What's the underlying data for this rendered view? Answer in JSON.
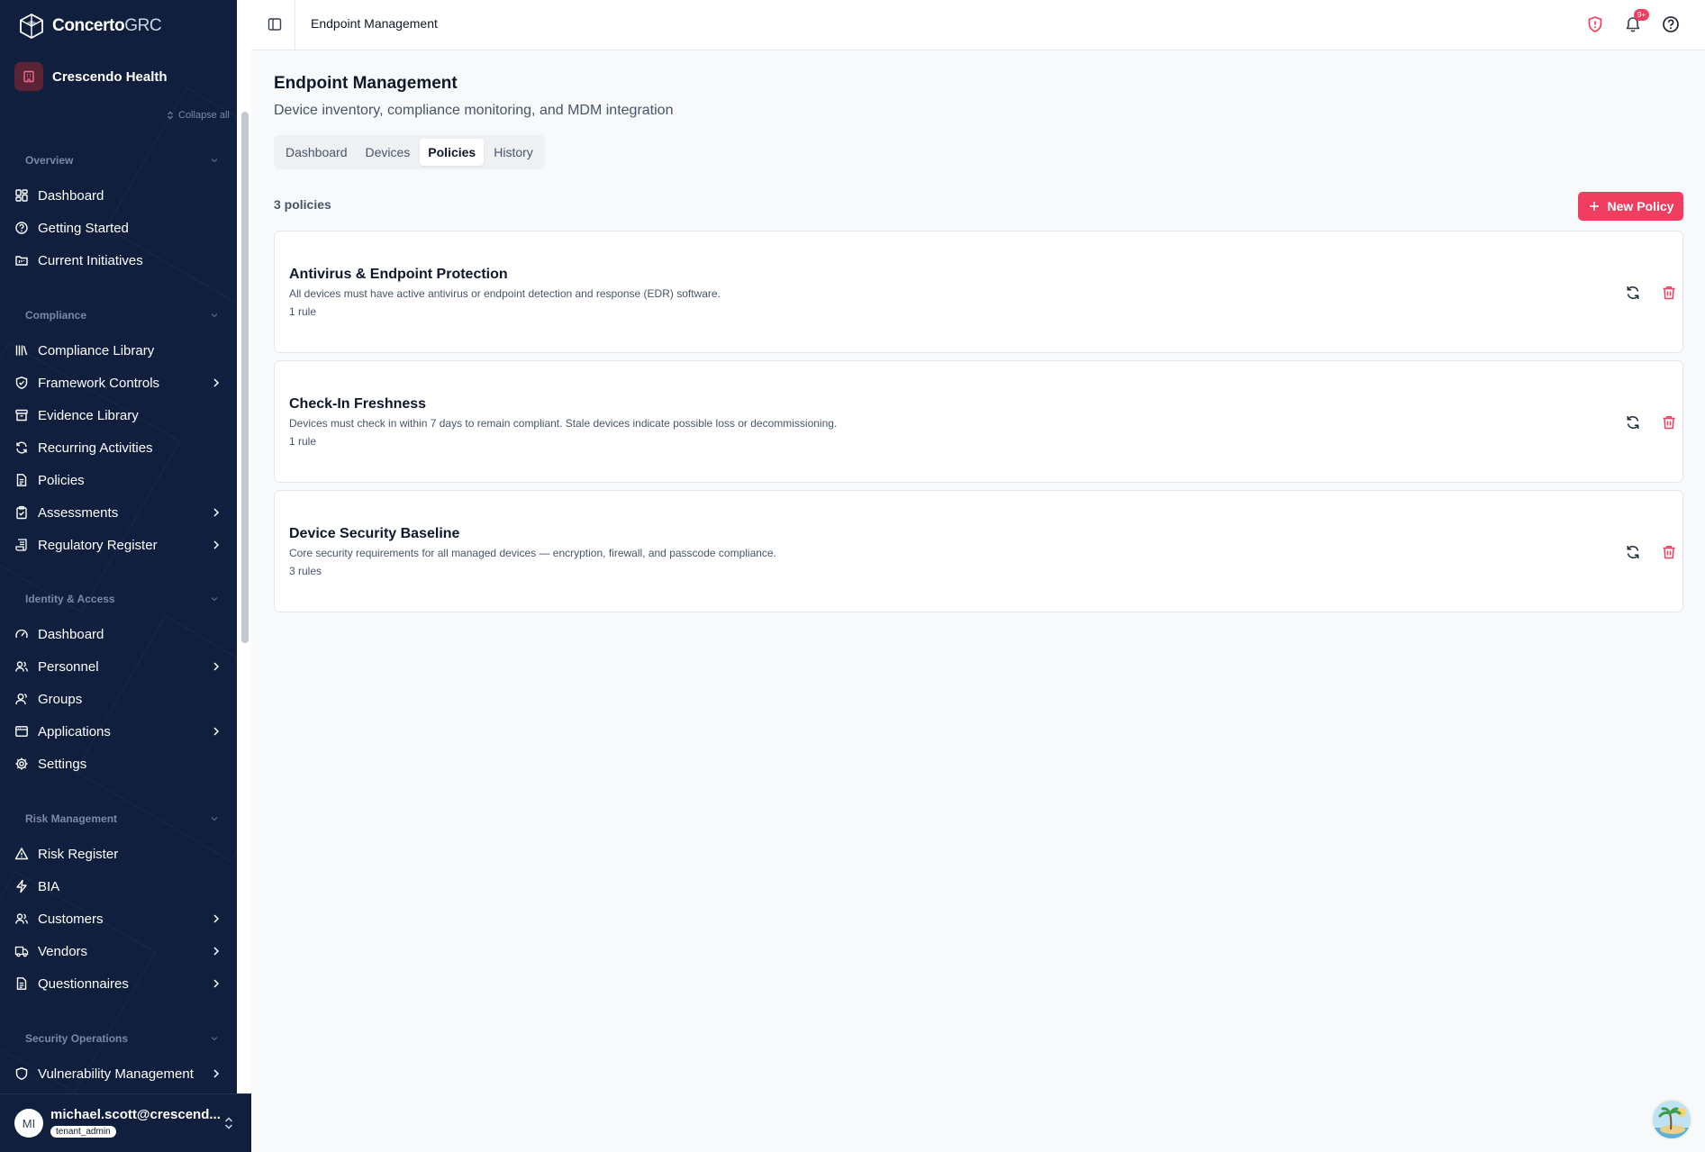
{
  "app": {
    "brand_bold": "Concerto",
    "brand_light": "GRC",
    "tenant": "Crescendo Health",
    "collapse_all": "Collapse all"
  },
  "sidebar": {
    "sections": [
      {
        "title": "Overview",
        "items": [
          {
            "label": "Dashboard",
            "icon": "dashboard-grid-icon",
            "has_children": false
          },
          {
            "label": "Getting Started",
            "icon": "help-circle-icon",
            "has_children": false
          },
          {
            "label": "Current Initiatives",
            "icon": "folder-kanban-icon",
            "has_children": false
          }
        ]
      },
      {
        "title": "Compliance",
        "items": [
          {
            "label": "Compliance Library",
            "icon": "library-icon",
            "has_children": false
          },
          {
            "label": "Framework Controls",
            "icon": "shield-check-icon",
            "has_children": true
          },
          {
            "label": "Evidence Library",
            "icon": "archive-icon",
            "has_children": false
          },
          {
            "label": "Recurring Activities",
            "icon": "refresh-icon",
            "has_children": false
          },
          {
            "label": "Policies",
            "icon": "file-text-icon",
            "has_children": false
          },
          {
            "label": "Assessments",
            "icon": "clipboard-check-icon",
            "has_children": true
          },
          {
            "label": "Regulatory Register",
            "icon": "scroll-icon",
            "has_children": true
          }
        ]
      },
      {
        "title": "Identity & Access",
        "items": [
          {
            "label": "Dashboard",
            "icon": "gauge-icon",
            "has_children": false
          },
          {
            "label": "Personnel",
            "icon": "users-icon",
            "has_children": true
          },
          {
            "label": "Groups",
            "icon": "user-group-icon",
            "has_children": false
          },
          {
            "label": "Applications",
            "icon": "app-window-icon",
            "has_children": true
          },
          {
            "label": "Settings",
            "icon": "gear-icon",
            "has_children": false
          }
        ]
      },
      {
        "title": "Risk Management",
        "items": [
          {
            "label": "Risk Register",
            "icon": "alert-triangle-icon",
            "has_children": false
          },
          {
            "label": "BIA",
            "icon": "zap-icon",
            "has_children": false
          },
          {
            "label": "Customers",
            "icon": "users-icon",
            "has_children": true
          },
          {
            "label": "Vendors",
            "icon": "truck-icon",
            "has_children": true
          },
          {
            "label": "Questionnaires",
            "icon": "file-text-icon",
            "has_children": true
          }
        ]
      },
      {
        "title": "Security Operations",
        "items": [
          {
            "label": "Vulnerability Management",
            "icon": "shield-icon",
            "has_children": true
          }
        ]
      }
    ]
  },
  "user": {
    "initials": "MI",
    "email": "michael.scott@crescend...",
    "role": "tenant_admin"
  },
  "topbar": {
    "title": "Endpoint Management",
    "notification_badge": "9+"
  },
  "page": {
    "title": "Endpoint Management",
    "subtitle": "Device inventory, compliance monitoring, and MDM integration",
    "tabs": [
      {
        "label": "Dashboard",
        "active": false
      },
      {
        "label": "Devices",
        "active": false
      },
      {
        "label": "Policies",
        "active": true
      },
      {
        "label": "History",
        "active": false
      }
    ],
    "count_label": "3 policies",
    "new_policy_label": "New Policy",
    "policies": [
      {
        "title": "Antivirus & Endpoint Protection",
        "description": "All devices must have active antivirus or endpoint detection and response (EDR) software.",
        "rules": "1 rule"
      },
      {
        "title": "Check-In Freshness",
        "description": "Devices must check in within 7 days to remain compliant. Stale devices indicate possible loss or decommissioning.",
        "rules": "1 rule"
      },
      {
        "title": "Device Security Baseline",
        "description": "Core security requirements for all managed devices — encryption, firewall, and passcode compliance.",
        "rules": "3 rules"
      }
    ]
  },
  "colors": {
    "sidebar_bg": "#0f1f3d",
    "accent": "#ef3e5f",
    "page_bg": "#f8f9fb"
  }
}
